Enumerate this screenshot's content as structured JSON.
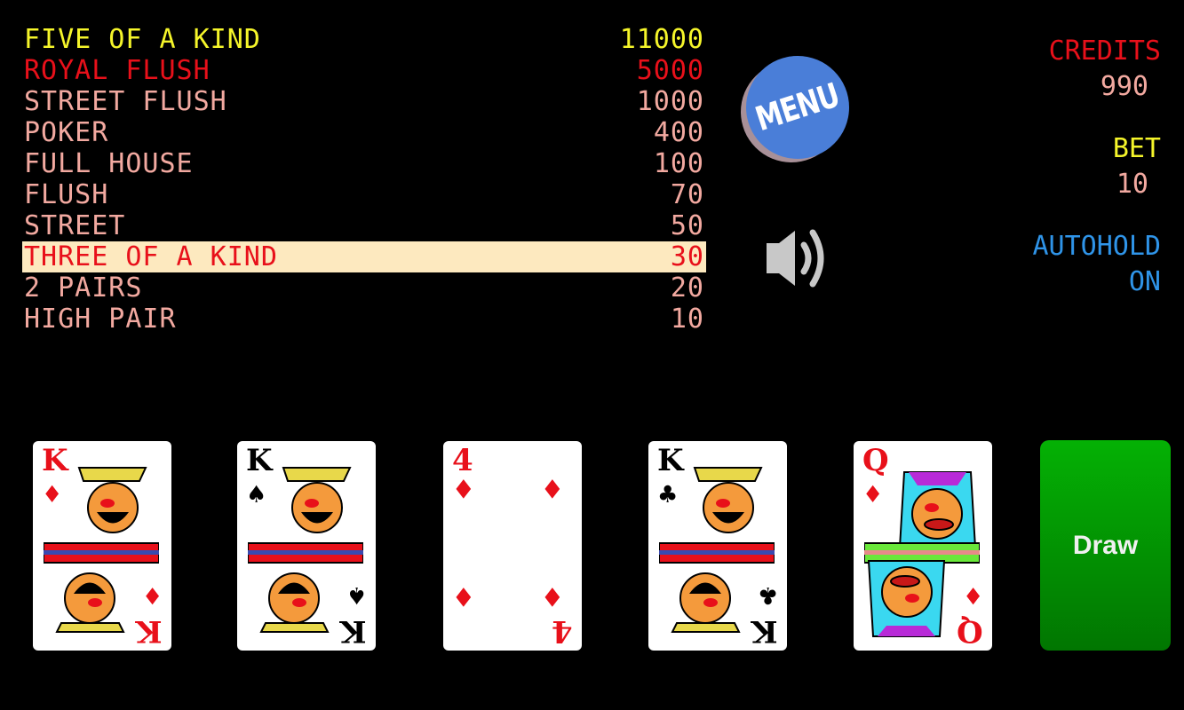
{
  "paytable": [
    {
      "hand": "FIVE OF A KIND",
      "payout": "11000",
      "style": "yellow"
    },
    {
      "hand": "ROYAL FLUSH",
      "payout": "5000",
      "style": "red"
    },
    {
      "hand": "STREET FLUSH",
      "payout": "1000",
      "style": "normal"
    },
    {
      "hand": "POKER",
      "payout": "400",
      "style": "normal"
    },
    {
      "hand": "FULL HOUSE",
      "payout": "100",
      "style": "normal"
    },
    {
      "hand": "FLUSH",
      "payout": "70",
      "style": "normal"
    },
    {
      "hand": "STREET",
      "payout": "50",
      "style": "normal"
    },
    {
      "hand": "THREE OF A KIND",
      "payout": "30",
      "style": "highlight"
    },
    {
      "hand": "2 PAIRS",
      "payout": "20",
      "style": "normal"
    },
    {
      "hand": "HIGH PAIR",
      "payout": "10",
      "style": "normal"
    }
  ],
  "menu": {
    "label": "MENU"
  },
  "sound": {
    "state": "on",
    "icon": "speaker-icon"
  },
  "status": {
    "credits_label": "CREDITS",
    "credits_value": "990",
    "bet_label": "BET",
    "bet_value": "10",
    "autohold_label": "AUTOHOLD",
    "autohold_value": "ON"
  },
  "cards": [
    {
      "rank": "K",
      "suit": "♦",
      "suit_name": "diamonds",
      "color": "red",
      "face": "king"
    },
    {
      "rank": "K",
      "suit": "♠",
      "suit_name": "spades",
      "color": "black",
      "face": "king"
    },
    {
      "rank": "4",
      "suit": "♦",
      "suit_name": "diamonds",
      "color": "red",
      "face": "pips"
    },
    {
      "rank": "K",
      "suit": "♣",
      "suit_name": "clubs",
      "color": "black",
      "face": "king"
    },
    {
      "rank": "Q",
      "suit": "♦",
      "suit_name": "diamonds",
      "color": "red",
      "face": "queen"
    }
  ],
  "draw": {
    "label": "Draw"
  },
  "colors": {
    "background": "#000000",
    "paytable_text": "#f2a9a0",
    "top_prize": "#f5f52a",
    "royal": "#e8101a",
    "highlight_bg": "#fde9bf",
    "menu_blue": "#4a7ed8",
    "autohold_blue": "#2f94e8",
    "draw_green": "#04b104"
  }
}
